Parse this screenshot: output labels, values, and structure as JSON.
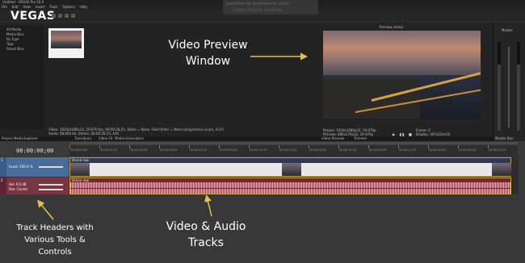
{
  "window": {
    "title": "Untitled - VEGAS Pro 16.0",
    "menu": [
      "File",
      "Edit",
      "View",
      "Insert",
      "Tools",
      "Options",
      "Help"
    ],
    "logo": "VEGAS"
  },
  "tooltip": {
    "line1": "workflow for professional video",
    "line2": "highly efficient workflow"
  },
  "explorer": {
    "tree_items": [
      "All Media",
      "Media Bins",
      "By Type",
      "Tags",
      "Smart Bins"
    ],
    "media_info_1": "Video: 1920x1080x32, 29.970 fps, 00:00:28;25, Alpha = None, Field Order = None (progressive scan), 4:2:0",
    "media_info_2": "Audio: 48,000 Hz, Stereo, 00:00:28;25, AAC",
    "tabs": [
      "Project Media",
      "Explorer",
      "Transitions",
      "Video FX",
      "Media Generators"
    ]
  },
  "preview": {
    "quality": "Preview (Auto)",
    "info_project": "Project:   1920x1080x32, 29.970p",
    "info_preview": "Preview:   480x270x32, 29.970p",
    "info_display": "Display:   397x224x32",
    "info_frame": "Frame:   0",
    "tabs": [
      "Video Preview",
      "Trimmer"
    ]
  },
  "master": {
    "label": "Master",
    "tab": "Master Bus",
    "levels": {
      "left": 0.75,
      "right": 0.75
    }
  },
  "timeline": {
    "timecode": "00:00:00;00",
    "ruler_labels": [
      "00:00:00;00",
      "00:00:01;29",
      "00:00:03;29",
      "00:00:05;29",
      "00:00:07;29",
      "00:00:09;29",
      "00:00:11;29",
      "00:00:13;29",
      "00:00:15;29",
      "00:00:17;29",
      "00:00:19;29",
      "00:00:21;29",
      "00:00:23;29",
      "00:00:25;29",
      "00:00:27;29"
    ],
    "video_track": {
      "number": "1",
      "level": "Level: 100.0 %",
      "clip_name": "Drone raw"
    },
    "audio_track": {
      "number": "2",
      "vol": "Vol:   0.0 dB",
      "pan": "Pan:   Center",
      "clip_name": "Drone raw"
    }
  },
  "annotations": {
    "preview_line1": "Video Preview",
    "preview_line2": "Window",
    "headers_line1": "Track Headers with",
    "headers_line2": "Various Tools &",
    "headers_line3": "Controls",
    "tracks_line1": "Video & Audio",
    "tracks_line2": "Tracks"
  },
  "colors": {
    "annotation_arrow": "#e2c24a",
    "video_track": "#4a6c99",
    "audio_track": "#7a3545",
    "clip_border": "#c7a14a"
  }
}
